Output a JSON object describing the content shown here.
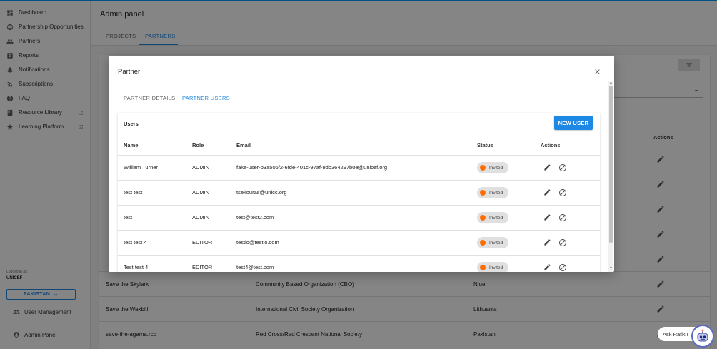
{
  "sidebar": {
    "items": [
      {
        "label": "Dashboard",
        "icon": "dashboard-icon"
      },
      {
        "label": "Partnership Opportunities",
        "icon": "globe-icon"
      },
      {
        "label": "Partners",
        "icon": "people-icon"
      },
      {
        "label": "Reports",
        "icon": "reports-icon"
      },
      {
        "label": "Notifications",
        "icon": "bell-icon"
      },
      {
        "label": "Subscriptions",
        "icon": "rss-icon"
      },
      {
        "label": "FAQ",
        "icon": "help-icon"
      },
      {
        "label": "Resource Library",
        "icon": "book-icon",
        "external": true
      },
      {
        "label": "Learning Platform",
        "icon": "star-icon",
        "external": true
      }
    ],
    "logged_in_label": "Logged in as:",
    "org": "UNICEF",
    "country": "PAKISTAN",
    "user_management": "User Management",
    "admin_panel": "Admin Panel"
  },
  "main": {
    "title": "Admin panel",
    "tabs": [
      "PROJECTS",
      "PARTNERS"
    ],
    "active_tab": "PARTNERS",
    "actions_header": "Actions",
    "background_rows": [
      {
        "name": "Save the Skylark",
        "type": "Community Based Organization (CBO)",
        "country": "Niue"
      },
      {
        "name": "Save the Waxbill",
        "type": "International Civil Society Organization",
        "country": "Lithuania"
      },
      {
        "name": "save-the-agama.rcc",
        "type": "Red Cross/Red Crescent National Society",
        "country": "Pakistan"
      }
    ]
  },
  "modal": {
    "title": "Partner",
    "tabs": [
      "PARTNER DETAILS",
      "PARTNER USERS"
    ],
    "active_tab": "PARTNER USERS",
    "users_title": "Users",
    "new_user_label": "NEW USER",
    "columns": [
      "Name",
      "Role",
      "Email",
      "Status",
      "Actions"
    ],
    "rows": [
      {
        "name": "William Turner",
        "role": "ADMIN",
        "email": "fake-user-b3a506f2-6fde-401c-97af-9db364297b0e@unicef.org",
        "status": "Invited"
      },
      {
        "name": "test test",
        "role": "ADMIN",
        "email": "tsekouras@unicc.org",
        "status": "Invited"
      },
      {
        "name": "test",
        "role": "ADMIN",
        "email": "test@test2.com",
        "status": "Invited"
      },
      {
        "name": "test test 4",
        "role": "EDITOR",
        "email": "testio@testio.com",
        "status": "Invited"
      },
      {
        "name": "Test test 4",
        "role": "EDITOR",
        "email": "test4@test.com",
        "status": "Invited"
      }
    ]
  },
  "assistant": {
    "label": "Ask Rafiki!"
  },
  "colors": {
    "accent": "#1e88e5",
    "status_invited": "#ff6d00"
  }
}
